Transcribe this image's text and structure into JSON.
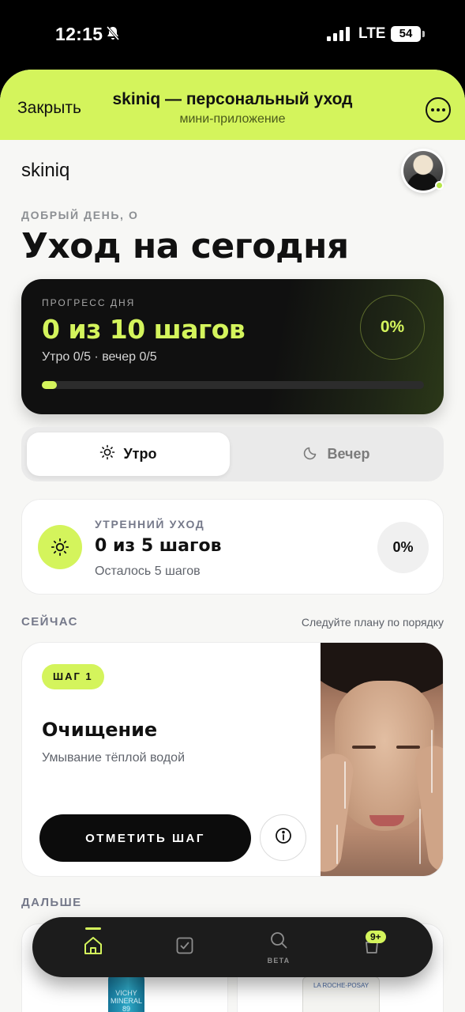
{
  "status_bar": {
    "time": "12:15",
    "network": "LTE",
    "battery": "54"
  },
  "mini_app": {
    "close_label": "Закрыть",
    "title": "skiniq — персональный уход",
    "subtitle": "мини-приложение"
  },
  "brand": "skiniq",
  "greeting": "ДОБРЫЙ ДЕНЬ, О",
  "page_title": "Уход на сегодня",
  "daily_progress": {
    "label": "ПРОГРЕСС ДНЯ",
    "value": "0 из 10 шагов",
    "detail": "Утро 0/5 · вечер 0/5",
    "percent": "0%",
    "fraction": 0
  },
  "segmented": {
    "morning": "Утро",
    "evening": "Вечер",
    "selected": "morning"
  },
  "routine": {
    "label": "УТРЕННИЙ УХОД",
    "value": "0 из 5 шагов",
    "remaining": "Осталось 5 шагов",
    "percent": "0%"
  },
  "now_section": {
    "title": "СЕЙЧАС",
    "hint": "Следуйте плану по порядку"
  },
  "current_step": {
    "badge": "ШАГ 1",
    "title": "Очищение",
    "description": "Умывание тёплой водой",
    "action": "ОТМЕТИТЬ ШАГ"
  },
  "next_section": {
    "title": "ДАЛЬШЕ"
  },
  "next_products": [
    {
      "label": "VICHY MINERAL 89"
    },
    {
      "label": "LA ROCHE-POSAY"
    }
  ],
  "tabbar": {
    "search_badge": "BETA",
    "cart_badge": "9+",
    "selected": "home"
  },
  "colors": {
    "accent": "#d4f45c",
    "dark": "#0c0c0c",
    "background": "#f7f7f5"
  }
}
